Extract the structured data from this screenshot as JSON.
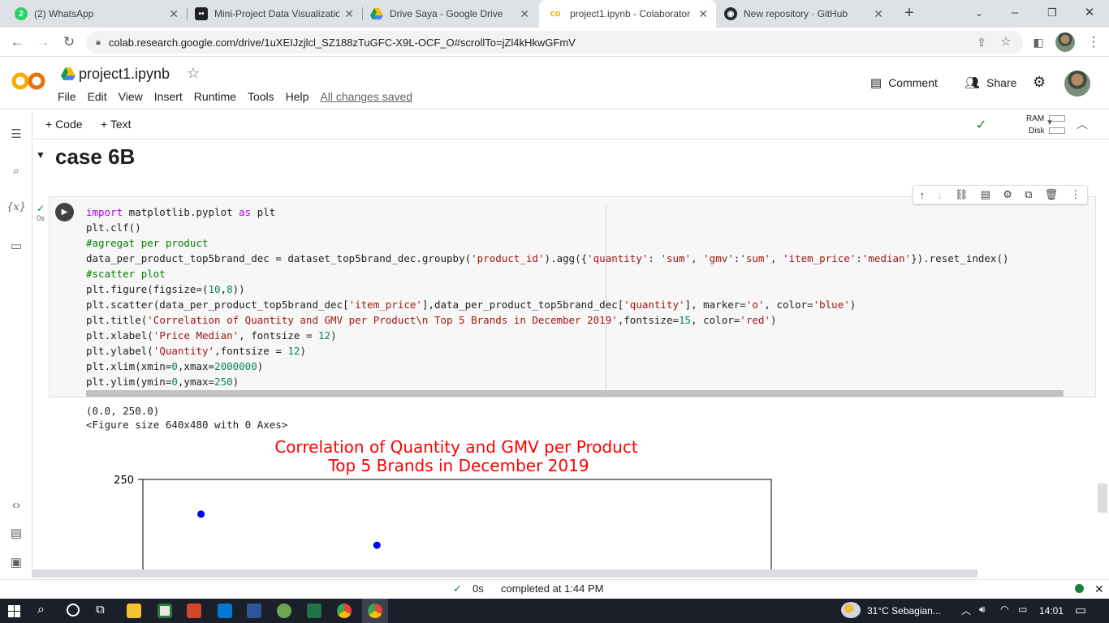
{
  "browser": {
    "tabs": [
      {
        "title": "(2) WhatsApp",
        "icon": "whatsapp-icon",
        "color": "#25d366",
        "badge": "2"
      },
      {
        "title": "Mini-Project Data Visualizatio",
        "icon": "dots-icon",
        "color": "#202124"
      },
      {
        "title": "Drive Saya - Google Drive",
        "icon": "drive-icon",
        "color": "#fbbc04"
      },
      {
        "title": "project1.ipynb - Colaborator",
        "icon": "colab-icon",
        "color": "#f9ab00",
        "active": true
      },
      {
        "title": "New repository · GitHub",
        "icon": "github-icon",
        "color": "#24292f"
      }
    ],
    "new_tab": "+",
    "url": "colab.research.google.com/drive/1uXEIJzjlcl_SZ188zTuGFC-X9L-OCF_O#scrollTo=jZl4kHkwGFmV"
  },
  "colab": {
    "logo_text": "CO",
    "notebook_title": "project1.ipynb",
    "menu": [
      "File",
      "Edit",
      "View",
      "Insert",
      "Runtime",
      "Tools",
      "Help"
    ],
    "save_status": "All changes saved",
    "comment_label": "Comment",
    "share_label": "Share"
  },
  "toolbar": {
    "add_code": "+ Code",
    "add_text": "+ Text",
    "ram_label": "RAM",
    "disk_label": "Disk"
  },
  "section": {
    "title": "case 6B"
  },
  "cell": {
    "exec_time": "0s",
    "code_lines": [
      "import matplotlib.pyplot as plt",
      "plt.clf()",
      "#agregat per product",
      "data_per_product_top5brand_dec = dataset_top5brand_dec.groupby('product_id').agg({'quantity': 'sum', 'gmv':'sum', 'item_price':'median'}).reset_index()",
      "#scatter plot",
      "plt.figure(figsize=(10,8))",
      "plt.scatter(data_per_product_top5brand_dec['item_price'],data_per_product_top5brand_dec['quantity'], marker='o', color='blue')",
      "plt.title('Correlation of Quantity and GMV per Product\\n Top 5 Brands in December 2019',fontsize=15, color='red')",
      "plt.xlabel('Price Median', fontsize = 12)",
      "plt.ylabel('Quantity',fontsize = 12)",
      "plt.xlim(xmin=0,xmax=2000000)",
      "plt.ylim(ymin=0,ymax=250)"
    ],
    "output_lines": [
      "(0.0, 250.0)",
      "<Figure size 640x480 with 0 Axes>"
    ]
  },
  "chart_data": {
    "type": "scatter",
    "title_line1": "Correlation of Quantity and GMV per Product",
    "title_line2": "Top 5 Brands in December 2019",
    "title_color": "#ff0000",
    "marker_color": "#0000ff",
    "ylim": [
      0,
      250
    ],
    "xlim": [
      0,
      2000000
    ],
    "y_tick_visible": "250",
    "points": [
      {
        "x": 185000,
        "y": 222
      },
      {
        "x": 745000,
        "y": 197
      }
    ]
  },
  "status": {
    "check_time": "0s",
    "completed": "completed at 1:44 PM"
  },
  "taskbar": {
    "weather": "31°C  Sebagian...",
    "time": "14:01"
  }
}
